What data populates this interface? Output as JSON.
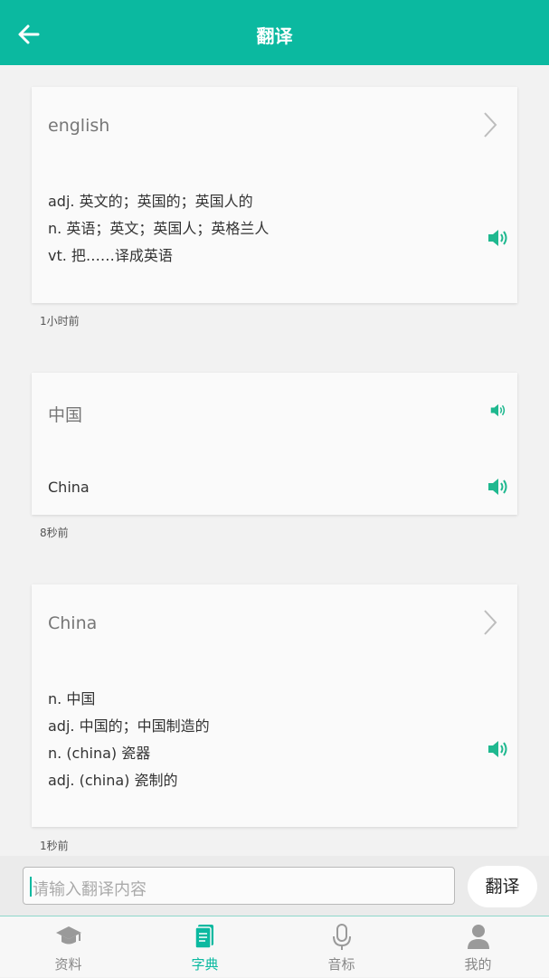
{
  "header": {
    "title": "翻译",
    "back_icon": "arrow-left-icon"
  },
  "history": [
    {
      "source": "english",
      "lines": [
        "adj. 英文的；英国的；英国人的",
        "n. 英语；英文；英国人；英格兰人",
        "vt. 把……译成英语"
      ],
      "time": "1小时前"
    },
    {
      "source": "中国",
      "lines": [
        "China"
      ],
      "time": "8秒前"
    },
    {
      "source": "China",
      "lines": [
        "n. 中国",
        "adj. 中国的；中国制造的",
        "n. (china) 瓷器",
        "adj. (china) 瓷制的"
      ],
      "time": "1秒前"
    }
  ],
  "input": {
    "placeholder": "请输入翻译内容"
  },
  "translate_button": "翻译",
  "tabs": [
    {
      "label": "资料",
      "icon": "graduation-cap-icon"
    },
    {
      "label": "字典",
      "icon": "dictionary-icon",
      "active": true
    },
    {
      "label": "音标",
      "icon": "microphone-icon"
    },
    {
      "label": "我的",
      "icon": "person-icon"
    }
  ],
  "colors": {
    "accent": "#0bb9a0",
    "speaker": "#1fb88f"
  }
}
